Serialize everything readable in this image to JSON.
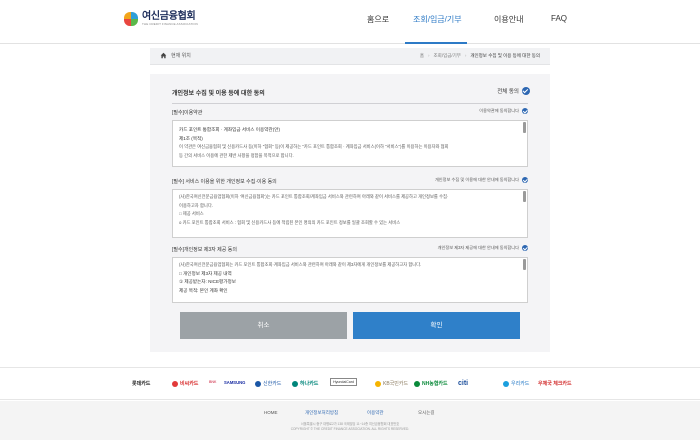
{
  "header": {
    "logo_name": "여신금융협회",
    "logo_sub": "THE CREDIT FINANCE ASSOCIATION",
    "nav": [
      "홈으로",
      "조회/입금/기부",
      "이용안내",
      "FAQ"
    ],
    "active_nav": "조회/입금/기부"
  },
  "breadcrumb": {
    "label": "현재 위치",
    "items": [
      "홈",
      "조회/입금/기부",
      "개인정보 수집 및 이용 등에 대한 동의"
    ]
  },
  "consent": {
    "title": "개인정보 수집 및 이용 등에 대한 동의",
    "agree_all": "전체 동의",
    "sections": [
      {
        "title": "[필수]이용약관",
        "agree_label": "이용약관에 동의합니다",
        "lines": [
          "카드 포인트 통합조회 · 계좌입금 서비스 이용약관(안)",
          "제1조 (목적)",
          "이 약관은 여신금융협회 및 신용카드사 등(이하 \"협회\" 등)이 제공하는 \"카드 포인트 통합조회 · 계좌입금 서비스(이하 \"서비스\")를 이용하는 이용자와 협회",
          "등 간의 서비스 이용에 관한 제반 사항을 정함을 목적으로 합니다."
        ]
      },
      {
        "title": "[필수] 서비스 이용을 위한 개인정보 수집·이용 동의",
        "agree_label": "개인정보 수집 및 이용에 대한 안내에 동의합니다",
        "lines": [
          "(사)한국여신전문금융업협회(이하 '여신금융협회')는 카드 포인트 통합조회/계좌입금 서비스와 관련하여 아래와 같이 서비스를 제공하고 개인정보를 수집·",
          "이용하고자 합니다.",
          "□ 제공 서비스",
          "o 카드 포인트 통합조회 서비스 : 협회 및 신용카드사 등에 적립된 본인 명의의 카드 포인트 정보를 일괄 조회할 수 있는 서비스"
        ]
      },
      {
        "title": "[필수]개인정보 제3자 제공 동의",
        "agree_label": "개인정보 제3자 제공에 대한 안내에 동의합니다",
        "lines": [
          "(사)한국여신전문금융업협회는 카드 포인트 통합조회·계좌입금 서비스와 관련하여 아래와 같이 제3자에게 개인정보를 제공하고자 합니다.",
          "□ 개인정보 제3자 제공 내역",
          "① 제공받는자: NICE평가정보",
          "제공 목적: 본인 계좌 확인"
        ]
      }
    ],
    "cancel_label": "취소",
    "confirm_label": "확인"
  },
  "cards": [
    "롯데카드",
    "비씨카드",
    "BNK",
    "SAMSUNG",
    "신한카드",
    "하나카드",
    "HyundaiCard",
    "KB국민카드",
    "NH농협카드",
    "citi",
    "우리카드",
    "우체국 체크카드"
  ],
  "footer": {
    "links": [
      "HOME",
      "개인정보처리방침",
      "이용약관",
      "오시는길"
    ],
    "address": "서울특별시 중구 대평로2가 138 국제빌딩 11~14층 여신금융협회 대표번호",
    "copyright": "COPYRIGHT © THE CREDIT FINANCE ASSOCIATION. ALL RIGHTS RESERVED."
  },
  "colors": {
    "accent": "#2f80c9",
    "cancel": "#9ca2a6",
    "check": "#2d67b2"
  }
}
